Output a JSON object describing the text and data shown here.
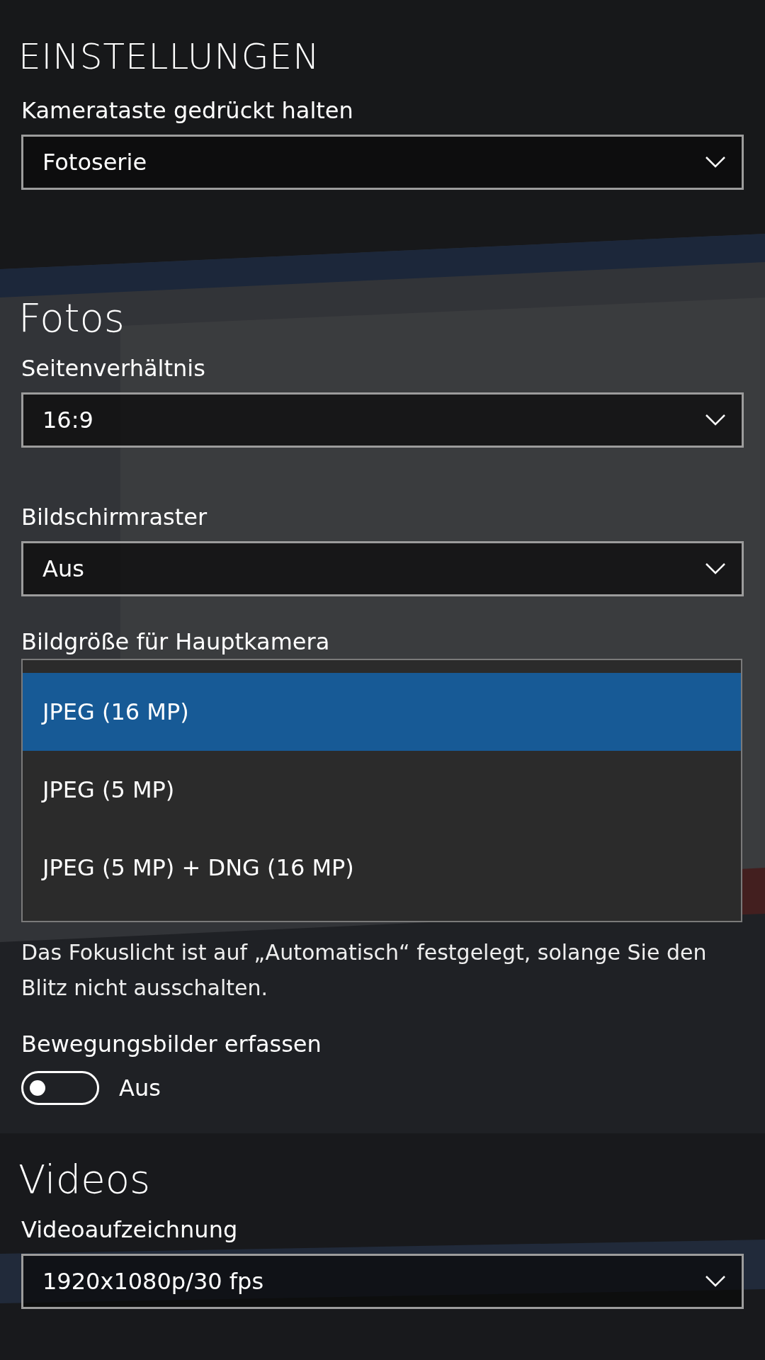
{
  "title": "EINSTELLUNGEN",
  "sections": [
    {
      "fields": [
        {
          "kind": "dropdown",
          "label": "Kamerataste gedrückt halten",
          "value": "Fotoserie"
        }
      ]
    },
    {
      "heading": "Fotos",
      "fields": [
        {
          "kind": "dropdown",
          "label": "Seitenverhältnis",
          "value": "16:9"
        },
        {
          "kind": "dropdown",
          "label": "Bildschirmraster",
          "value": "Aus"
        },
        {
          "kind": "covered",
          "label": "Bildgröße für Hauptkamera"
        },
        {
          "kind": "note",
          "text": "Das Fokuslicht ist auf „Automatisch“ festgelegt, solange Sie den Blitz nicht ausschalten."
        },
        {
          "kind": "toggle",
          "label": "Bewegungsbilder erfassen",
          "on": false,
          "state_text": "Aus"
        }
      ]
    },
    {
      "heading": "Videos",
      "fields": [
        {
          "kind": "dropdown",
          "label": "Videoaufzeichnung",
          "value": "1920x1080p/30 fps"
        }
      ]
    }
  ],
  "open_list": {
    "items": [
      {
        "label": "JPEG (16 MP)",
        "selected": true
      },
      {
        "label": "JPEG (5 MP)",
        "selected": false
      },
      {
        "label": "JPEG (5 MP) + DNG (16 MP)",
        "selected": false
      }
    ]
  }
}
